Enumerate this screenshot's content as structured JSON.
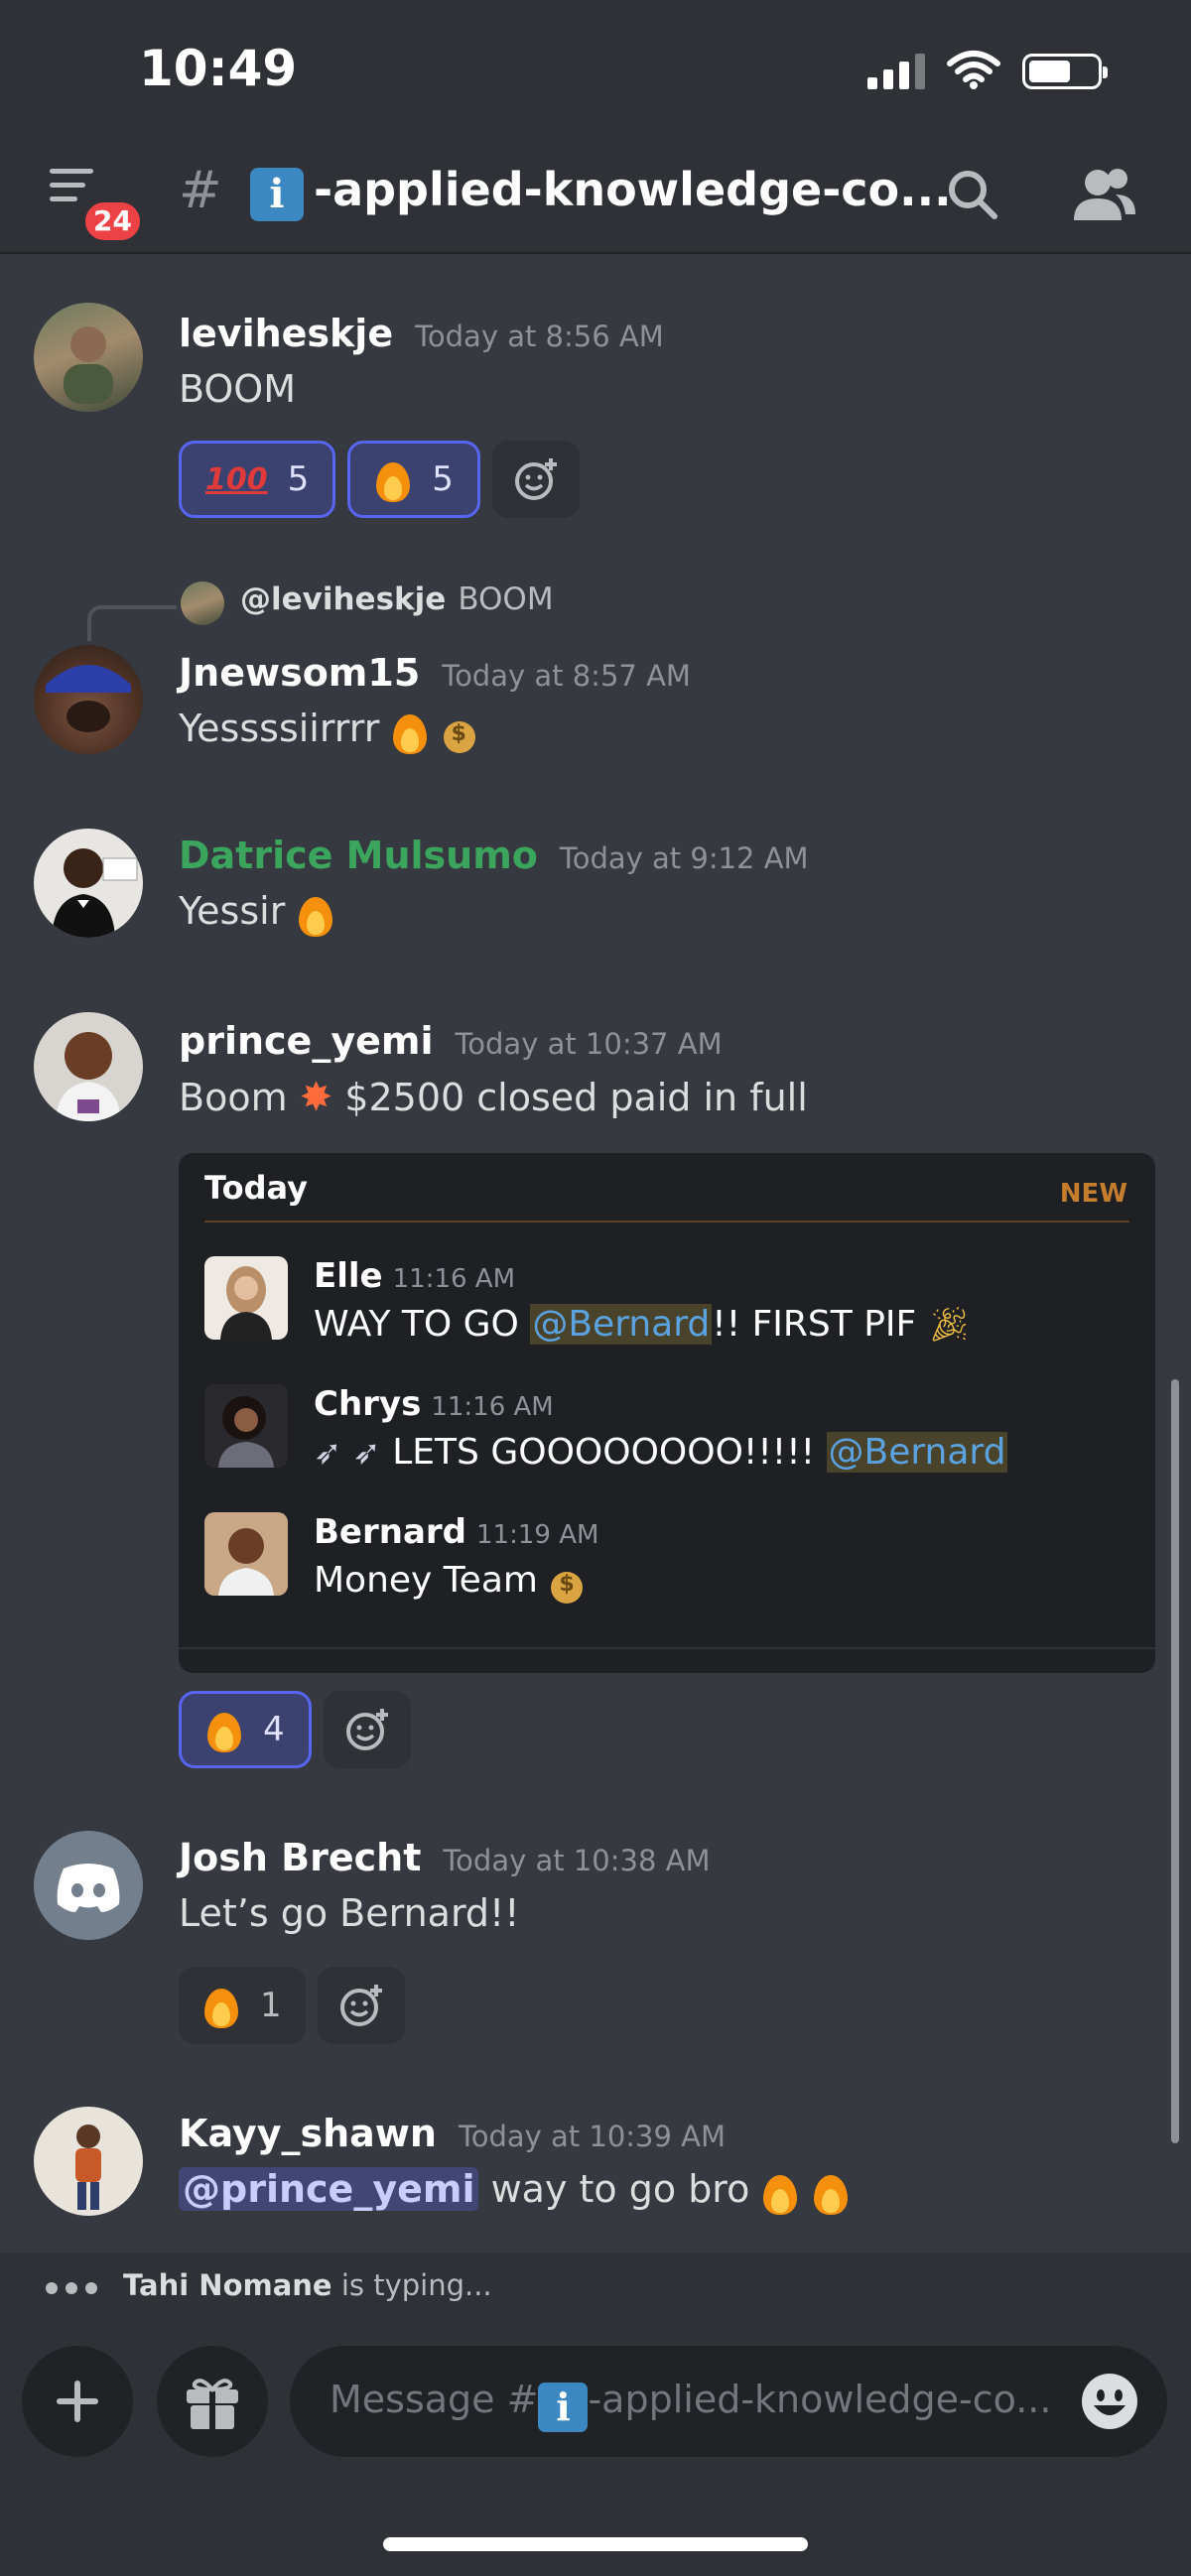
{
  "status_bar": {
    "time": "10:49"
  },
  "header": {
    "badge_count": "24",
    "hash": "#",
    "channel_icon": "i",
    "channel_name": "-applied-knowledge-co..."
  },
  "messages": [
    {
      "author": "leviheskje",
      "timestamp": "Today at 8:56 AM",
      "text": "BOOM",
      "reactions": [
        {
          "emoji": "100",
          "count": "5"
        },
        {
          "emoji": "fire",
          "count": "5"
        }
      ]
    },
    {
      "reply_to": {
        "author": "@leviheskje",
        "text": "BOOM"
      },
      "author": "Jnewsom15",
      "timestamp": "Today at 8:57 AM",
      "text": "Yessssiirrrr"
    },
    {
      "author": "Datrice Mulsumo",
      "author_color": "#3ba55d",
      "timestamp": "Today at 9:12 AM",
      "text": "Yessir"
    },
    {
      "author": "prince_yemi",
      "timestamp": "Today at 10:37 AM",
      "text_before": "Boom",
      "text_after": "$2500 closed paid in full",
      "embed": {
        "header": "Today",
        "new_label": "NEW",
        "messages": [
          {
            "author": "Elle",
            "timestamp": "11:16 AM",
            "text_before": "WAY TO GO ",
            "mention": "@Bernard",
            "text_after": "!! FIRST PIF"
          },
          {
            "author": "Chrys",
            "timestamp": "11:16 AM",
            "text_before": "LETS GOOOOOOOO!!!!! ",
            "mention": "@Bernard"
          },
          {
            "author": "Bernard",
            "timestamp": "11:19 AM",
            "text": "Money Team"
          }
        ]
      },
      "reactions": [
        {
          "emoji": "fire",
          "count": "4"
        }
      ]
    },
    {
      "author": "Josh Brecht",
      "timestamp": "Today at 10:38 AM",
      "text": "Let’s go Bernard!!",
      "reactions": [
        {
          "emoji": "fire",
          "count": "1"
        }
      ]
    },
    {
      "author": "Kayy_shawn",
      "timestamp": "Today at 10:39 AM",
      "mention": "@prince_yemi",
      "text": "way to go bro"
    }
  ],
  "typing": {
    "user": "Tahi Nomane",
    "text": "is typing..."
  },
  "composer": {
    "placeholder": "Message #",
    "channel_icon": "i",
    "channel_name": "-applied-knowledge-co..."
  },
  "colors": {
    "accent": "#5865f2",
    "background": "#36393f",
    "header": "#2f3136",
    "mention_bg": "#414675",
    "new_label": "#c57e2d"
  }
}
